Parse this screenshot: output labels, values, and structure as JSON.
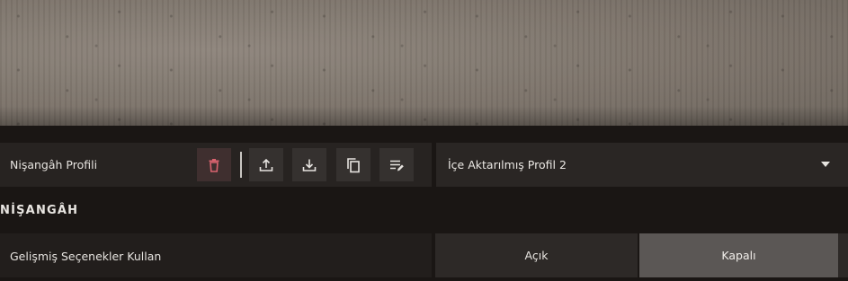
{
  "crosshair_profile": {
    "label": "Nişangâh Profili",
    "tools": [
      {
        "name": "delete",
        "icon": "trash-icon",
        "color": "#d9636f"
      },
      {
        "name": "export",
        "icon": "upload-icon"
      },
      {
        "name": "import",
        "icon": "download-icon"
      },
      {
        "name": "copy",
        "icon": "copy-icon"
      },
      {
        "name": "rename",
        "icon": "edit-list-icon"
      }
    ],
    "selected_profile": "İçe Aktarılmış Profil 2"
  },
  "section": {
    "title": "NİŞANGÂH"
  },
  "advanced_options": {
    "label": "Gelişmiş Seçenekler Kullan",
    "on_label": "Açık",
    "off_label": "Kapalı",
    "selected": "Kapalı"
  }
}
